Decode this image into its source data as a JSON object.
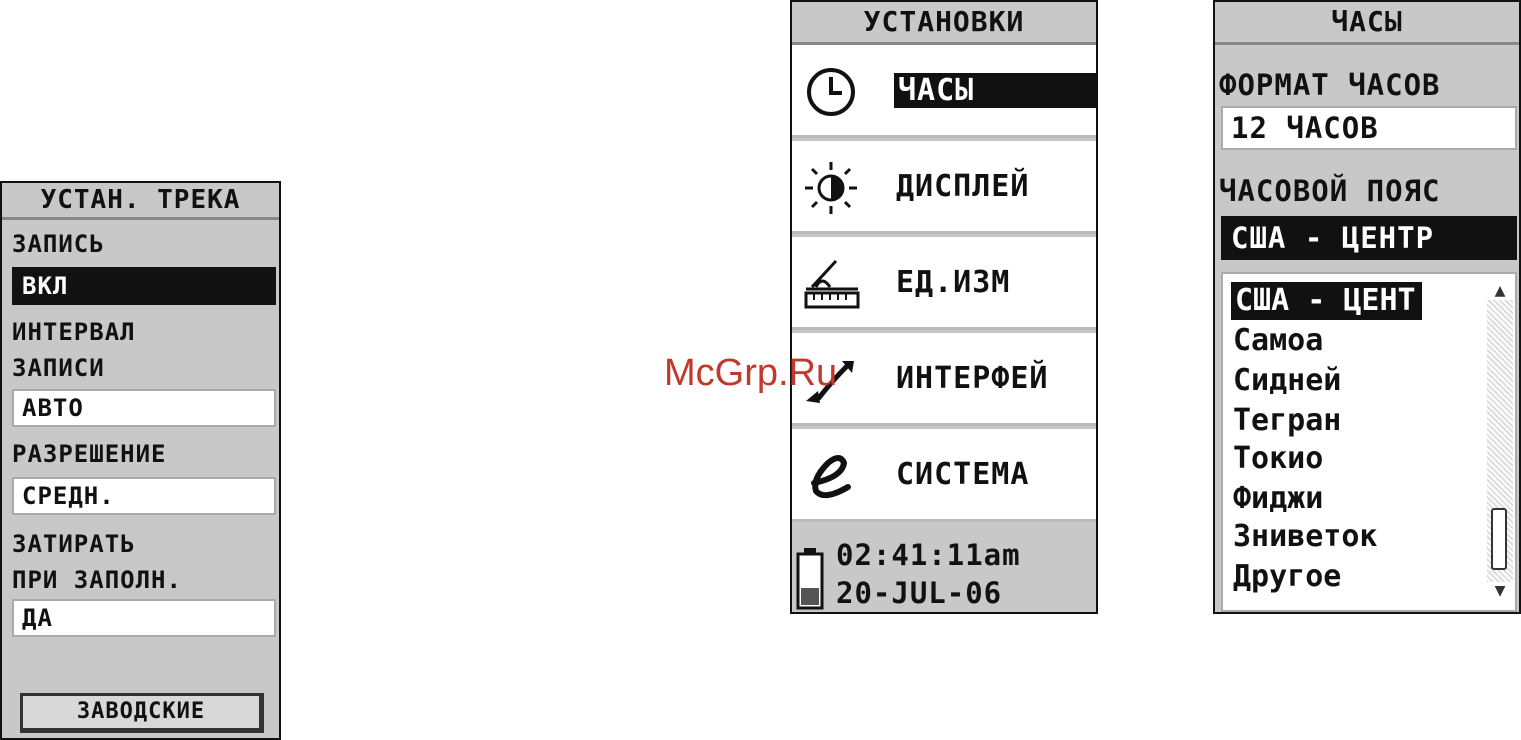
{
  "track_setup": {
    "title": "УСТАН. ТРЕКА",
    "record_label": "ЗАПИСЬ",
    "record_value": "ВКЛ",
    "interval_label_1": "ИНТЕРВАЛ",
    "interval_label_2": "ЗАПИСИ",
    "interval_value": "АВТО",
    "resolution_label": "РАЗРЕШЕНИЕ",
    "resolution_value": "СРЕДН.",
    "wrap_label_1": "ЗАТИРАТЬ",
    "wrap_label_2": "ПРИ ЗАПОЛН.",
    "wrap_value": "ДА",
    "defaults_button": "ЗАВОДСКИЕ"
  },
  "setup_menu": {
    "title": "УСТАНОВКИ",
    "items": [
      {
        "label": "ЧАСЫ",
        "icon": "clock-icon"
      },
      {
        "label": "ДИСПЛЕЙ",
        "icon": "brightness-icon"
      },
      {
        "label": "ЕД.ИЗМ",
        "icon": "ruler-icon"
      },
      {
        "label": "ИНТЕРФЕЙ",
        "icon": "interface-arrows-icon"
      },
      {
        "label": "СИСТЕМА",
        "icon": "system-e-icon"
      }
    ],
    "status_time": "02:41:11am",
    "status_date": "20-JUL-06"
  },
  "clock": {
    "title": "ЧАСЫ",
    "format_label": "ФОРМАТ ЧАСОВ",
    "format_value": "12 ЧАСОВ",
    "timezone_label": "ЧАСОВОЙ ПОЯС",
    "timezone_value": "США - ЦЕНТР",
    "timezone_options": [
      "США - ЦЕНТ",
      "Самоа",
      "Сидней",
      "Тегран",
      "Токио",
      "Фиджи",
      "Зниветок",
      "Другое"
    ]
  },
  "watermark": "McGrp.Ru"
}
